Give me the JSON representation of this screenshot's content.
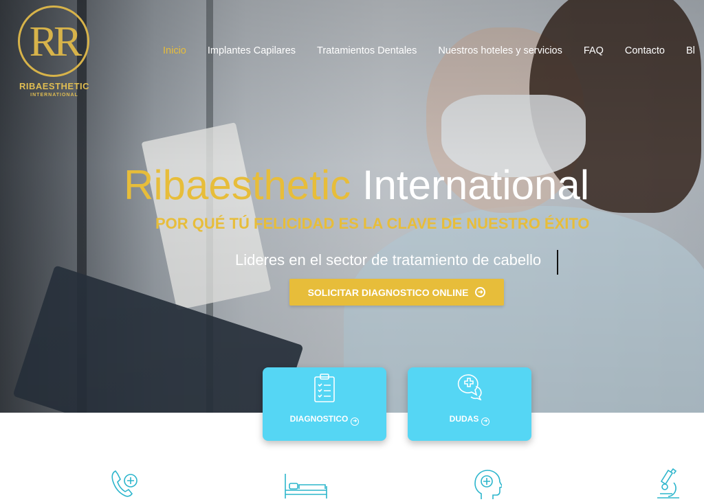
{
  "brand": {
    "logo_letters": "RR",
    "name": "RIBAESTHETIC",
    "sub": "INTERNATIONAL",
    "gold": "#e7bd3a"
  },
  "nav": {
    "items": [
      {
        "label": "Inicio",
        "active": true
      },
      {
        "label": "Implantes Capilares"
      },
      {
        "label": "Tratamientos Dentales"
      },
      {
        "label": "Nuestros hoteles y servicios"
      },
      {
        "label": "FAQ"
      },
      {
        "label": "Contacto"
      },
      {
        "label": "Bl"
      }
    ]
  },
  "hero": {
    "title_gold": "Ribaesthetic",
    "title_white": "International",
    "tagline": "POR QUÉ TÚ FELICIDAD ES LA CLAVE DE NUESTRO ÉXITO",
    "lead": "Lideres en el sector de tratamiento de cabello",
    "cta_label": "SOLICITAR DIAGNOSTICO ONLINE"
  },
  "cards": [
    {
      "label": "DIAGNOSTICO",
      "icon": "clipboard-checklist-icon"
    },
    {
      "label": "DUDAS",
      "icon": "chat-medical-icon"
    }
  ],
  "features": [
    {
      "icon": "phone-medical-icon"
    },
    {
      "icon": "hospital-bed-icon"
    },
    {
      "icon": "head-medical-icon"
    },
    {
      "icon": "microscope-icon"
    }
  ],
  "colors": {
    "card_bg": "#55d6f4",
    "icon_teal": "#2bb5cc"
  }
}
